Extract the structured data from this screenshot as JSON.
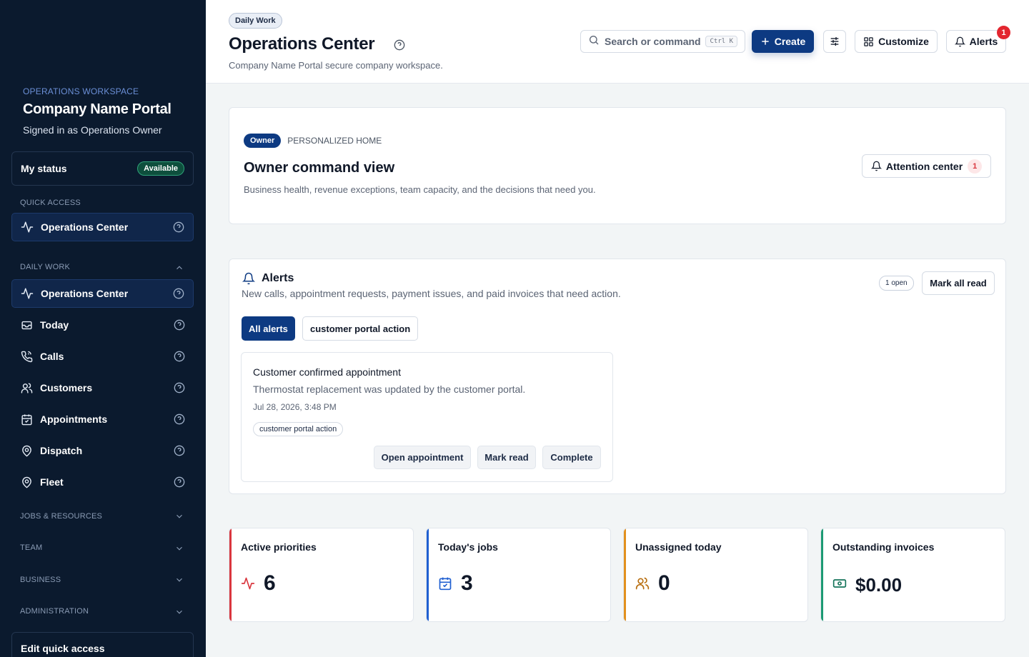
{
  "sidebar": {
    "workspace_label": "OPERATIONS WORKSPACE",
    "workspace_name": "Company Name Portal",
    "signed_in": "Signed in as Operations Owner",
    "my_status_label": "My status",
    "my_status_value": "Available",
    "quick_access_label": "QUICK ACCESS",
    "quick_access_item": "Operations Center",
    "daily_work_label": "DAILY WORK",
    "daily_items": [
      {
        "label": "Operations Center",
        "icon": "activity-icon"
      },
      {
        "label": "Today",
        "icon": "inbox-icon"
      },
      {
        "label": "Calls",
        "icon": "phone-icon"
      },
      {
        "label": "Customers",
        "icon": "users-icon"
      },
      {
        "label": "Appointments",
        "icon": "calendar-icon"
      },
      {
        "label": "Dispatch",
        "icon": "map-pin-icon"
      },
      {
        "label": "Fleet",
        "icon": "map-pin-icon"
      }
    ],
    "collapsed_sections": [
      "JOBS & RESOURCES",
      "TEAM",
      "BUSINESS",
      "ADMINISTRATION"
    ],
    "edit_quick_access": "Edit quick access"
  },
  "header": {
    "breadcrumb": "Daily Work",
    "title": "Operations Center",
    "subtitle": "Company Name Portal secure company workspace.",
    "search_placeholder": "Search or command",
    "search_shortcut": "Ctrl K",
    "create_label": "Create",
    "customize_label": "Customize",
    "alerts_label": "Alerts",
    "alerts_count": "1"
  },
  "owner_card": {
    "role_pill": "Owner",
    "eyebrow": "PERSONALIZED HOME",
    "title": "Owner command view",
    "description": "Business health, revenue exceptions, team capacity, and the decisions that need you.",
    "attention_label": "Attention center",
    "attention_count": "1"
  },
  "alerts_card": {
    "title": "Alerts",
    "description": "New calls, appointment requests, payment issues, and paid invoices that need action.",
    "open_badge": "1 open",
    "mark_all_read": "Mark all read",
    "filters": [
      "All alerts",
      "customer portal action"
    ],
    "alert": {
      "title": "Customer confirmed appointment",
      "body": "Thermostat replacement was updated by the customer portal.",
      "timestamp": "Jul 28, 2026, 3:48 PM",
      "tag": "customer portal action",
      "actions": [
        "Open appointment",
        "Mark read",
        "Complete"
      ]
    }
  },
  "kpis": [
    {
      "label": "Active priorities",
      "value": "6",
      "color": "#d9363e",
      "icon": "activity-icon"
    },
    {
      "label": "Today's jobs",
      "value": "3",
      "color": "#1f5fd1",
      "icon": "calendar-check-icon"
    },
    {
      "label": "Unassigned today",
      "value": "0",
      "color": "#e2901e",
      "icon": "users-icon"
    },
    {
      "label": "Outstanding invoices",
      "value": "$0.00",
      "color": "#1c9a73",
      "icon": "banknote-icon"
    }
  ]
}
